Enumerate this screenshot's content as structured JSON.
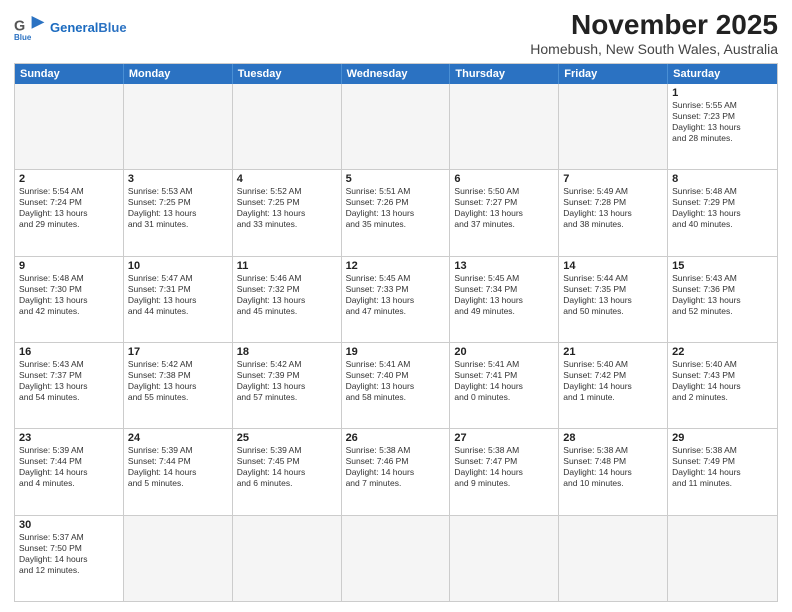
{
  "header": {
    "logo_general": "General",
    "logo_blue": "Blue",
    "month_title": "November 2025",
    "subtitle": "Homebush, New South Wales, Australia"
  },
  "weekdays": [
    "Sunday",
    "Monday",
    "Tuesday",
    "Wednesday",
    "Thursday",
    "Friday",
    "Saturday"
  ],
  "rows": [
    [
      {
        "day": "",
        "text": "",
        "empty": true
      },
      {
        "day": "",
        "text": "",
        "empty": true
      },
      {
        "day": "",
        "text": "",
        "empty": true
      },
      {
        "day": "",
        "text": "",
        "empty": true
      },
      {
        "day": "",
        "text": "",
        "empty": true
      },
      {
        "day": "",
        "text": "",
        "empty": true
      },
      {
        "day": "1",
        "text": "Sunrise: 5:55 AM\nSunset: 7:23 PM\nDaylight: 13 hours\nand 28 minutes."
      }
    ],
    [
      {
        "day": "2",
        "text": "Sunrise: 5:54 AM\nSunset: 7:24 PM\nDaylight: 13 hours\nand 29 minutes."
      },
      {
        "day": "3",
        "text": "Sunrise: 5:53 AM\nSunset: 7:25 PM\nDaylight: 13 hours\nand 31 minutes."
      },
      {
        "day": "4",
        "text": "Sunrise: 5:52 AM\nSunset: 7:25 PM\nDaylight: 13 hours\nand 33 minutes."
      },
      {
        "day": "5",
        "text": "Sunrise: 5:51 AM\nSunset: 7:26 PM\nDaylight: 13 hours\nand 35 minutes."
      },
      {
        "day": "6",
        "text": "Sunrise: 5:50 AM\nSunset: 7:27 PM\nDaylight: 13 hours\nand 37 minutes."
      },
      {
        "day": "7",
        "text": "Sunrise: 5:49 AM\nSunset: 7:28 PM\nDaylight: 13 hours\nand 38 minutes."
      },
      {
        "day": "8",
        "text": "Sunrise: 5:48 AM\nSunset: 7:29 PM\nDaylight: 13 hours\nand 40 minutes."
      }
    ],
    [
      {
        "day": "9",
        "text": "Sunrise: 5:48 AM\nSunset: 7:30 PM\nDaylight: 13 hours\nand 42 minutes."
      },
      {
        "day": "10",
        "text": "Sunrise: 5:47 AM\nSunset: 7:31 PM\nDaylight: 13 hours\nand 44 minutes."
      },
      {
        "day": "11",
        "text": "Sunrise: 5:46 AM\nSunset: 7:32 PM\nDaylight: 13 hours\nand 45 minutes."
      },
      {
        "day": "12",
        "text": "Sunrise: 5:45 AM\nSunset: 7:33 PM\nDaylight: 13 hours\nand 47 minutes."
      },
      {
        "day": "13",
        "text": "Sunrise: 5:45 AM\nSunset: 7:34 PM\nDaylight: 13 hours\nand 49 minutes."
      },
      {
        "day": "14",
        "text": "Sunrise: 5:44 AM\nSunset: 7:35 PM\nDaylight: 13 hours\nand 50 minutes."
      },
      {
        "day": "15",
        "text": "Sunrise: 5:43 AM\nSunset: 7:36 PM\nDaylight: 13 hours\nand 52 minutes."
      }
    ],
    [
      {
        "day": "16",
        "text": "Sunrise: 5:43 AM\nSunset: 7:37 PM\nDaylight: 13 hours\nand 54 minutes."
      },
      {
        "day": "17",
        "text": "Sunrise: 5:42 AM\nSunset: 7:38 PM\nDaylight: 13 hours\nand 55 minutes."
      },
      {
        "day": "18",
        "text": "Sunrise: 5:42 AM\nSunset: 7:39 PM\nDaylight: 13 hours\nand 57 minutes."
      },
      {
        "day": "19",
        "text": "Sunrise: 5:41 AM\nSunset: 7:40 PM\nDaylight: 13 hours\nand 58 minutes."
      },
      {
        "day": "20",
        "text": "Sunrise: 5:41 AM\nSunset: 7:41 PM\nDaylight: 14 hours\nand 0 minutes."
      },
      {
        "day": "21",
        "text": "Sunrise: 5:40 AM\nSunset: 7:42 PM\nDaylight: 14 hours\nand 1 minute."
      },
      {
        "day": "22",
        "text": "Sunrise: 5:40 AM\nSunset: 7:43 PM\nDaylight: 14 hours\nand 2 minutes."
      }
    ],
    [
      {
        "day": "23",
        "text": "Sunrise: 5:39 AM\nSunset: 7:44 PM\nDaylight: 14 hours\nand 4 minutes."
      },
      {
        "day": "24",
        "text": "Sunrise: 5:39 AM\nSunset: 7:44 PM\nDaylight: 14 hours\nand 5 minutes."
      },
      {
        "day": "25",
        "text": "Sunrise: 5:39 AM\nSunset: 7:45 PM\nDaylight: 14 hours\nand 6 minutes."
      },
      {
        "day": "26",
        "text": "Sunrise: 5:38 AM\nSunset: 7:46 PM\nDaylight: 14 hours\nand 7 minutes."
      },
      {
        "day": "27",
        "text": "Sunrise: 5:38 AM\nSunset: 7:47 PM\nDaylight: 14 hours\nand 9 minutes."
      },
      {
        "day": "28",
        "text": "Sunrise: 5:38 AM\nSunset: 7:48 PM\nDaylight: 14 hours\nand 10 minutes."
      },
      {
        "day": "29",
        "text": "Sunrise: 5:38 AM\nSunset: 7:49 PM\nDaylight: 14 hours\nand 11 minutes."
      }
    ],
    [
      {
        "day": "30",
        "text": "Sunrise: 5:37 AM\nSunset: 7:50 PM\nDaylight: 14 hours\nand 12 minutes."
      },
      {
        "day": "",
        "text": "",
        "empty": true
      },
      {
        "day": "",
        "text": "",
        "empty": true
      },
      {
        "day": "",
        "text": "",
        "empty": true
      },
      {
        "day": "",
        "text": "",
        "empty": true
      },
      {
        "day": "",
        "text": "",
        "empty": true
      },
      {
        "day": "",
        "text": "",
        "empty": true
      }
    ]
  ]
}
